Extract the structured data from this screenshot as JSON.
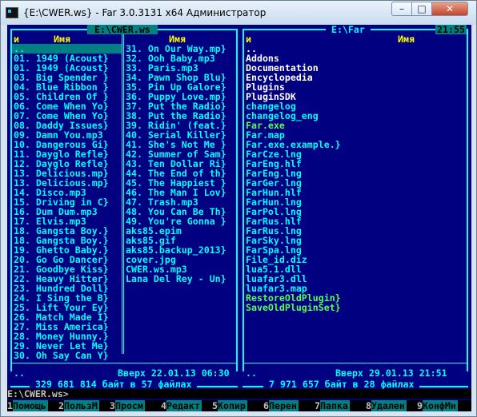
{
  "window": {
    "title": "{E:\\CWER.ws} - Far 3.0.3131 x64 Администратор",
    "min_glyph": "–",
    "max_glyph": "□",
    "close_glyph": "✕"
  },
  "left_panel": {
    "path": " E:\\CWER.ws ",
    "col_sort_marker": "и",
    "col1_header": "Имя",
    "col2_header": "Имя",
    "col1": [
      "..",
      "01. 1949 (Acoust}",
      "01. 1949 (Acoust}",
      "03. Big Spender }",
      "04. Blue Ribbon }",
      "05. Children Of }",
      "06. Come When Yo}",
      "07. Come When Yo}",
      "08. Daddy Issues}",
      "09. Damn You.mp3",
      "10. Dangerous Gi}",
      "11. Dayglo Refle}",
      "12. Dayglo Refle}",
      "13. Delicious.mp}",
      "13. Delicious.mp}",
      "14. Disco.mp3",
      "15. Driving in C}",
      "16. Dum Dum.mp3",
      "17. Elvis.mp3",
      "18. Gangsta Boy.}",
      "18. Gangsta Boy.}",
      "19. Ghetto Baby.}",
      "20. Go Go Dancer}",
      "21. Goodbye Kiss}",
      "22. Heavy Hitter}",
      "23. Hundred Doll}",
      "24. I Sing the B}",
      "25. Lift Your Ey}",
      "26. Match Made I}",
      "27. Miss America}",
      "28. Money Hunny.}",
      "29. Never Let Me}",
      "30. Oh Say Can Y}"
    ],
    "col2": [
      "31. On Our Way.mp}",
      "32. Ooh Baby.mp3",
      "33. Paris.mp3",
      "34. Pawn Shop Blu}",
      "35. Pin Up Galore}",
      "36. Puppy Love.mp}",
      "37. Put the Radio}",
      "38. Put the Radio}",
      "39. Ridin' (feat.}",
      "40. Serial Killer}",
      "41. She's Not Me }",
      "42. Summer of Sam}",
      "43. Ten Dollar Ri}",
      "44. The End of th}",
      "45. The Happiest }",
      "46. The Man I Lov}",
      "47. Trash.mp3",
      "48. You Can Be Th}",
      "49. You're Gonna }",
      "aks85.epim",
      "aks85.gif",
      "aks85.backup_2013}",
      "cover.jpg",
      "CWER.ws.mp3",
      "Lana Del Rey - Un}",
      "",
      "",
      "",
      "",
      "",
      "",
      "",
      ""
    ],
    "status_name": "..",
    "status_info": "Вверх 22.01.13 06:30",
    "summary": " 329 681 814 байт в 57 файлах "
  },
  "right_panel": {
    "path": " E:\\Far ",
    "clock": "21:55",
    "col_sort_marker": "и",
    "col1_header": "Имя",
    "items": [
      {
        "name": "..",
        "color": "white"
      },
      {
        "name": "Addons",
        "color": "white"
      },
      {
        "name": "Documentation",
        "color": "white"
      },
      {
        "name": "Encyclopedia",
        "color": "white"
      },
      {
        "name": "Plugins",
        "color": "white"
      },
      {
        "name": "PluginSDK",
        "color": "white"
      },
      {
        "name": "changelog",
        "color": "cyan"
      },
      {
        "name": "changelog_eng",
        "color": "cyan"
      },
      {
        "name": "Far.exe",
        "color": "green"
      },
      {
        "name": "Far.map",
        "color": "cyan"
      },
      {
        "name": "Far.exe.example.}",
        "color": "cyan"
      },
      {
        "name": "FarCze.lng",
        "color": "cyan"
      },
      {
        "name": "FarEng.hlf",
        "color": "cyan"
      },
      {
        "name": "FarEng.lng",
        "color": "cyan"
      },
      {
        "name": "FarGer.lng",
        "color": "cyan"
      },
      {
        "name": "FarHun.hlf",
        "color": "cyan"
      },
      {
        "name": "FarHun.lng",
        "color": "cyan"
      },
      {
        "name": "FarPol.lng",
        "color": "cyan"
      },
      {
        "name": "FarRus.hlf",
        "color": "cyan"
      },
      {
        "name": "FarRus.lng",
        "color": "cyan"
      },
      {
        "name": "FarSky.lng",
        "color": "cyan"
      },
      {
        "name": "FarSpa.lng",
        "color": "cyan"
      },
      {
        "name": "File_id.diz",
        "color": "cyan"
      },
      {
        "name": "lua5.1.dll",
        "color": "cyan"
      },
      {
        "name": "luafar3.dll",
        "color": "cyan"
      },
      {
        "name": "luafar3.map",
        "color": "cyan"
      },
      {
        "name": "RestoreOldPlugin}",
        "color": "green"
      },
      {
        "name": "SaveOldPluginSet}",
        "color": "green"
      }
    ],
    "status_name": "..",
    "status_info": "Вверх 29.01.13 21:51",
    "summary": " 7 971 657 байт в 28 файлах "
  },
  "command_line": "E:\\CWER.ws>",
  "keybar": [
    {
      "num": "1",
      "label": "Помощь"
    },
    {
      "num": "2",
      "label": "ПользМ"
    },
    {
      "num": "3",
      "label": "Просм"
    },
    {
      "num": "4",
      "label": "Редакт"
    },
    {
      "num": "5",
      "label": "Копир"
    },
    {
      "num": "6",
      "label": "Перен"
    },
    {
      "num": "7",
      "label": "Папка"
    },
    {
      "num": "8",
      "label": "Удален"
    },
    {
      "num": "9",
      "label": "КонфМн"
    }
  ],
  "colors": {
    "panel_bg": "#000080",
    "frame": "#00ffff",
    "header": "#ffff00",
    "dir": "#ffffff",
    "exe": "#55ff55",
    "cursor": "#008080"
  }
}
